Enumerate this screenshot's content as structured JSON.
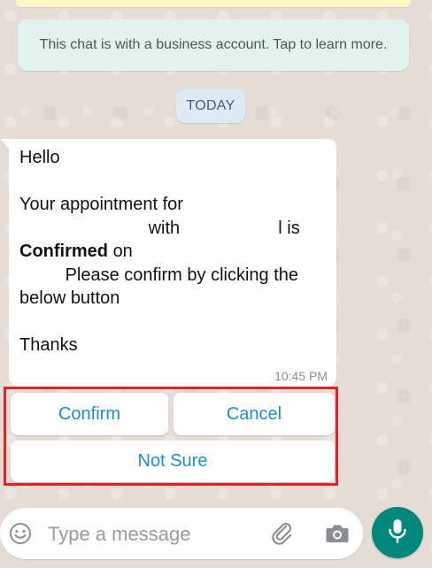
{
  "business_notice": "This chat is with a business account. Tap to learn more.",
  "date_label": "TODAY",
  "message": {
    "line1": "Hello",
    "line2": "Your appointment for",
    "line3a": "with",
    "line3b": "l is",
    "line4a": "Confirmed",
    "line4b": "on",
    "line5": "Please confirm by clicking the",
    "line6": "below button",
    "line7": "Thanks",
    "time": "10:45 PM"
  },
  "quick_replies": {
    "confirm": "Confirm",
    "cancel": "Cancel",
    "not_sure": "Not Sure"
  },
  "composer": {
    "placeholder": "Type a message"
  },
  "icons": {
    "emoji": "emoji-icon",
    "attach": "paperclip-icon",
    "camera": "camera-icon",
    "mic": "microphone-icon"
  },
  "colors": {
    "wallpaper": "#e5ddd5",
    "accent": "#00897b",
    "link": "#1d8fc7",
    "highlight": "#e32228"
  }
}
